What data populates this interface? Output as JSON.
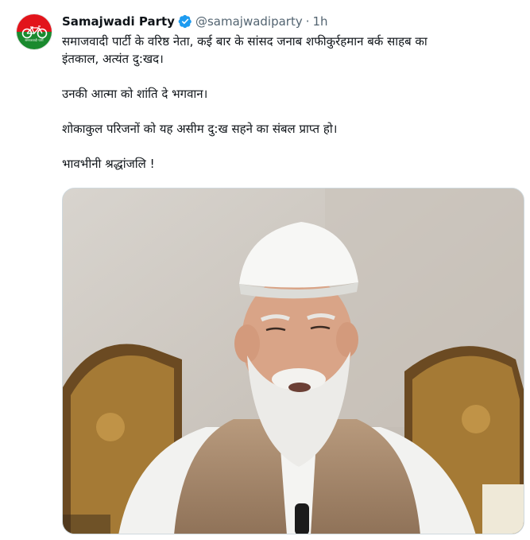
{
  "author": {
    "name": "Samajwadi Party",
    "handle": "@samajwadiparty",
    "separator": "·",
    "time": "1h",
    "verified": true,
    "avatar_caption": "समाजवादी पार्टी",
    "avatar_colors": {
      "top": "#e2141b",
      "bottom": "#1a8a2e"
    }
  },
  "tweet": {
    "lines": [
      "समाजवादी पार्टी के वरिष्ठ नेता, कई बार के सांसद जनाब शफीकुर्रहमान बर्क साहब का",
      "इंतकाल, अत्यंत दु:खद।",
      "उनकी आत्मा को शांति दे भगवान।",
      "शोकाकुल परिजनों को यह असीम दु:ख सहने का संबल प्राप्त हो।",
      "भावभीनी श्रद्धांजलि !"
    ]
  },
  "media": {
    "type": "photo"
  },
  "colors": {
    "verified": "#1d9bf0",
    "secondary_text": "#536471",
    "border": "#cfd9de"
  },
  "icons": [
    "verified-badge-icon",
    "cycle-logo-icon"
  ]
}
